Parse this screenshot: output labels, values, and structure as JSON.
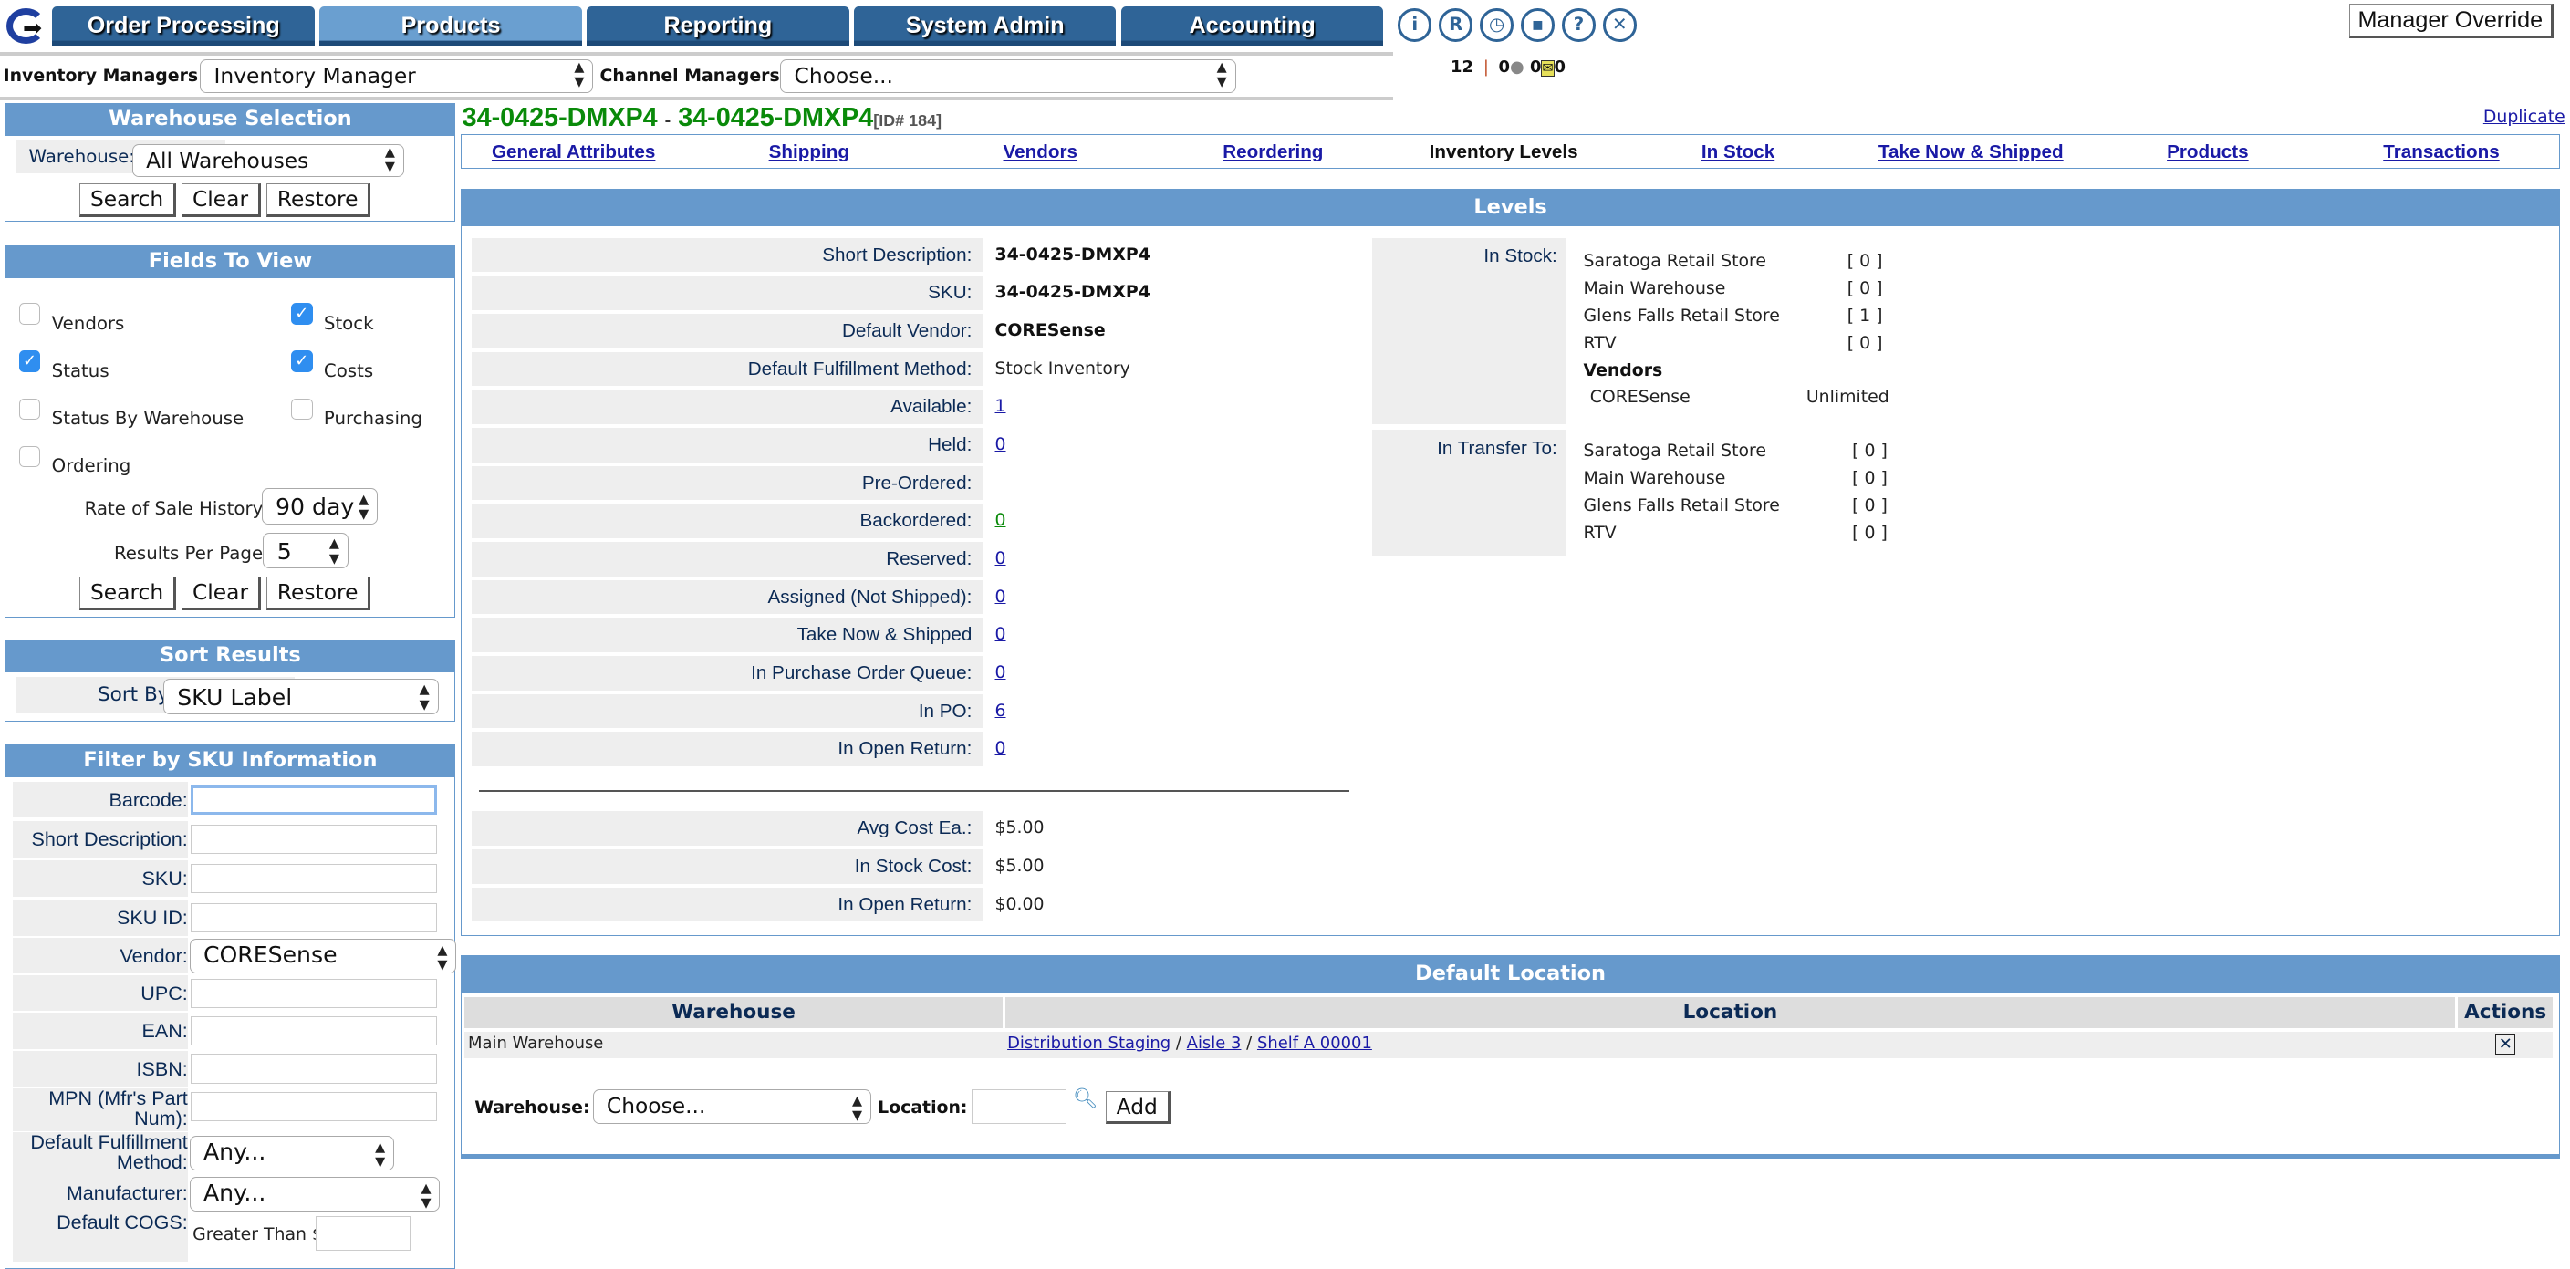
{
  "nav": {
    "tabs": [
      "Order Processing",
      "Products",
      "Reporting",
      "System Admin",
      "Accounting"
    ],
    "active_tab": "Products",
    "icons": [
      "info-icon",
      "registered-icon",
      "clock-icon",
      "save-icon",
      "help-icon",
      "close-icon"
    ],
    "manager_override": "Manager Override"
  },
  "managers": {
    "inventory_label": "Inventory Managers:",
    "inventory_value": "Inventory Manager",
    "channel_label": "Channel Managers:",
    "channel_value": "Choose..."
  },
  "counters": {
    "alerts": "12",
    "messages": "0",
    "mail_a": "0",
    "mail_b": "0"
  },
  "warehouse_selection": {
    "title": "Warehouse Selection",
    "label": "Warehouse:",
    "value": "All Warehouses",
    "search": "Search",
    "clear": "Clear",
    "restore": "Restore"
  },
  "fields_to_view": {
    "title": "Fields To View",
    "options": [
      {
        "label": "Vendors",
        "checked": false
      },
      {
        "label": "Stock",
        "checked": true
      },
      {
        "label": "Status",
        "checked": true
      },
      {
        "label": "Costs",
        "checked": true
      },
      {
        "label": "Status By Warehouse",
        "checked": false
      },
      {
        "label": "Purchasing",
        "checked": false
      },
      {
        "label": "Ordering",
        "checked": false
      }
    ],
    "rate_label": "Rate of Sale History:",
    "rate_value": "90 day",
    "results_label": "Results Per Page:",
    "results_value": "5",
    "search": "Search",
    "clear": "Clear",
    "restore": "Restore"
  },
  "sort": {
    "title": "Sort Results",
    "label": "Sort By:",
    "value": "SKU Label"
  },
  "filter": {
    "title": "Filter by SKU Information",
    "barcode": "Barcode:",
    "short_description": "Short Description:",
    "sku": "SKU:",
    "sku_id": "SKU ID:",
    "vendor": "Vendor:",
    "vendor_value": "CORESense",
    "upc": "UPC:",
    "ean": "EAN:",
    "isbn": "ISBN:",
    "mpn": "MPN (Mfr's Part Num):",
    "fulfillment": "Default Fulfillment Method:",
    "fulfillment_value": "Any...",
    "manufacturer": "Manufacturer:",
    "manufacturer_value": "Any...",
    "cogs": "Default COGS:",
    "cogs_prefix": "Greater Than $"
  },
  "product": {
    "title_a": "34-0425-DMXP4",
    "sep": "-",
    "title_b": "34-0425-DMXP4",
    "id": "[ID# 184]",
    "duplicate": "Duplicate"
  },
  "subtabs": [
    "General Attributes",
    "Shipping",
    "Vendors",
    "Reordering",
    "Inventory Levels",
    "In Stock",
    "Take Now & Shipped",
    "Products",
    "Transactions"
  ],
  "levels": {
    "title": "Levels",
    "rows": [
      {
        "label": "Short Description:",
        "value": "34-0425-DMXP4"
      },
      {
        "label": "SKU:",
        "value": "34-0425-DMXP4"
      },
      {
        "label": "Default Vendor:",
        "value": "CORESense"
      },
      {
        "label": "Default Fulfillment Method:",
        "value": "Stock Inventory"
      },
      {
        "label": "Available:",
        "value": "1"
      },
      {
        "label": "Held:",
        "value": "0"
      },
      {
        "label": "Pre-Ordered:",
        "value": ""
      },
      {
        "label": "Backordered:",
        "value": "0"
      },
      {
        "label": "Reserved:",
        "value": "0"
      },
      {
        "label": "Assigned (Not Shipped):",
        "value": "0"
      },
      {
        "label": "Take Now & Shipped",
        "value": "0"
      },
      {
        "label": "In Purchase Order Queue:",
        "value": "0"
      },
      {
        "label": "In PO:",
        "value": "6"
      },
      {
        "label": "In Open Return:",
        "value": "0"
      }
    ],
    "costs": [
      {
        "label": "Avg Cost Ea.:",
        "value": "$5.00"
      },
      {
        "label": "In Stock Cost:",
        "value": "$5.00"
      },
      {
        "label": "In Open Return:",
        "value": "$0.00"
      }
    ],
    "in_stock_label": "In Stock:",
    "in_stock": [
      {
        "name": "Saratoga Retail Store",
        "qty": "[ 0 ]"
      },
      {
        "name": "Main Warehouse",
        "qty": "[ 0 ]"
      },
      {
        "name": "Glens Falls Retail Store",
        "qty": "[ 1 ]"
      },
      {
        "name": "RTV",
        "qty": "[ 0 ]"
      }
    ],
    "vendors_label": "Vendors",
    "vendors": [
      {
        "name": "CORESense",
        "qty": "Unlimited"
      }
    ],
    "transfer_label": "In Transfer To:",
    "transfer": [
      {
        "name": "Saratoga Retail Store",
        "qty": "[ 0 ]"
      },
      {
        "name": "Main Warehouse",
        "qty": "[ 0 ]"
      },
      {
        "name": "Glens Falls Retail Store",
        "qty": "[ 0 ]"
      },
      {
        "name": "RTV",
        "qty": "[ 0 ]"
      }
    ]
  },
  "default_location": {
    "title": "Default Location",
    "headers": [
      "Warehouse",
      "Location",
      "Actions"
    ],
    "row": {
      "warehouse": "Main Warehouse",
      "path": [
        "Distribution Staging",
        "Aisle 3",
        "Shelf A 00001"
      ],
      "sep": "/"
    },
    "form_warehouse_label": "Warehouse:",
    "form_warehouse_value": "Choose...",
    "form_location_label": "Location:",
    "add": "Add"
  },
  "colors": {
    "header_blue": "#6699cc",
    "tab_blue": "#2f6497",
    "title_green": "#0a8a0a",
    "link": "#1a1aa6"
  }
}
